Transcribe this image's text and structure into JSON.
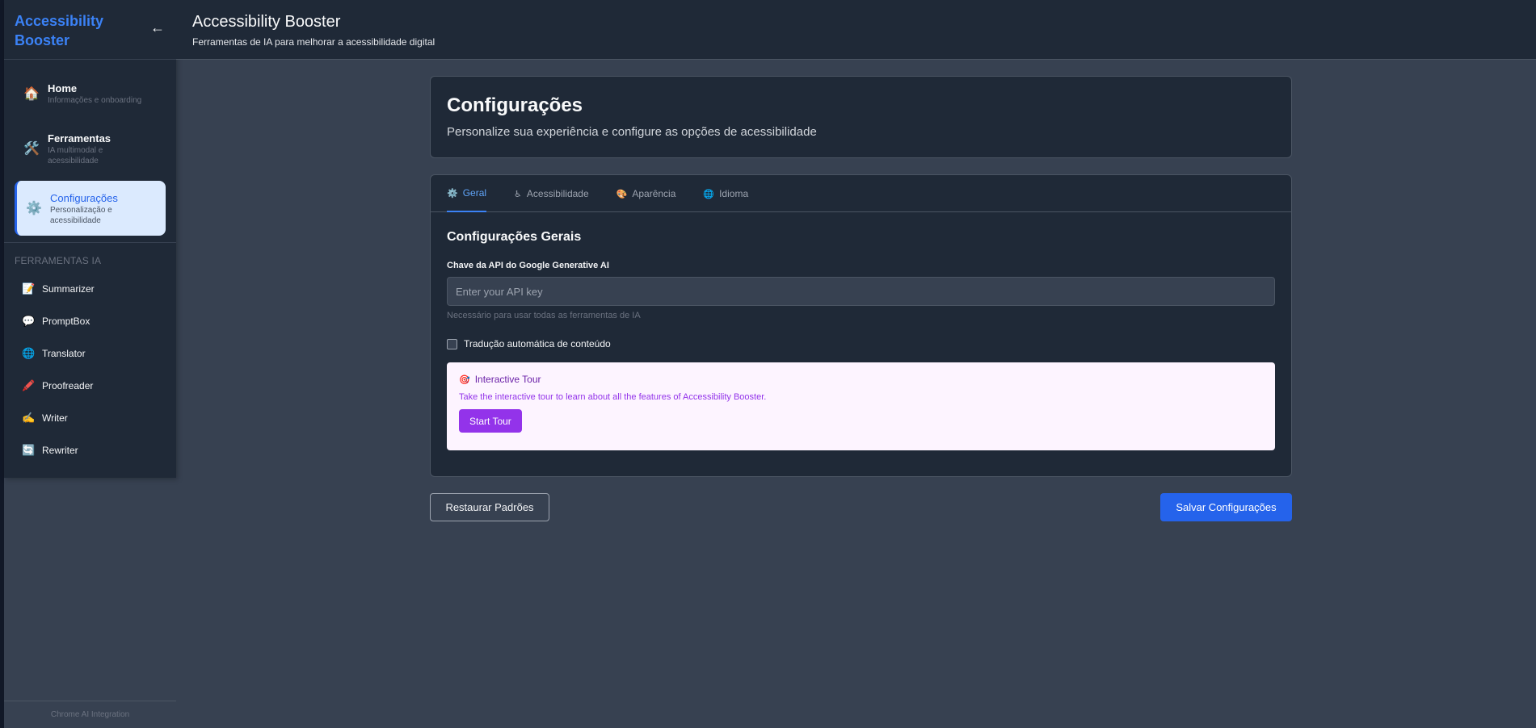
{
  "sidebar": {
    "brand": "Accessibility Booster",
    "collapse_icon": "←",
    "nav": [
      {
        "icon": "🏠",
        "title": "Home",
        "subtitle": "Informações e onboarding"
      },
      {
        "icon": "🛠️",
        "title": "Ferramentas",
        "subtitle": "IA multimodal e acessibilidade"
      },
      {
        "icon": "⚙️",
        "title": "Configurações",
        "subtitle": "Personalização e acessibilidade"
      }
    ],
    "section_label": "FERRAMENTAS IA",
    "tools": [
      {
        "icon": "📝",
        "label": "Summarizer"
      },
      {
        "icon": "💬",
        "label": "PromptBox"
      },
      {
        "icon": "🌐",
        "label": "Translator"
      },
      {
        "icon": "🖍️",
        "label": "Proofreader"
      },
      {
        "icon": "✍️",
        "label": "Writer"
      },
      {
        "icon": "🔄",
        "label": "Rewriter"
      }
    ],
    "footer": "Chrome AI Integration"
  },
  "header": {
    "title": "Accessibility Booster",
    "subtitle": "Ferramentas de IA para melhorar a acessibilidade digital"
  },
  "page": {
    "title": "Configurações",
    "subtitle": "Personalize sua experiência e configure as opções de acessibilidade"
  },
  "tabs": [
    {
      "icon": "⚙️",
      "label": "Geral"
    },
    {
      "icon": "♿",
      "label": "Acessibilidade"
    },
    {
      "icon": "🎨",
      "label": "Aparência"
    },
    {
      "icon": "🌐",
      "label": "Idioma"
    }
  ],
  "general": {
    "section_title": "Configurações Gerais",
    "api_label": "Chave da API do Google Generative AI",
    "api_value": "",
    "api_placeholder": "Enter your API key",
    "api_help": "Necessário para usar todas as ferramentas de IA",
    "auto_translate_label": "Tradução automática de conteúdo",
    "auto_translate_checked": false
  },
  "tour": {
    "icon": "🎯",
    "title": "Interactive Tour",
    "text": "Take the interactive tour to learn about all the features of Accessibility Booster.",
    "button": "Start Tour"
  },
  "actions": {
    "restore": "Restaurar Padrões",
    "save": "Salvar Configurações"
  },
  "colors": {
    "accent": "#2563eb",
    "tour_accent": "#9333ea",
    "background": "#374151",
    "panel": "#1f2937"
  }
}
